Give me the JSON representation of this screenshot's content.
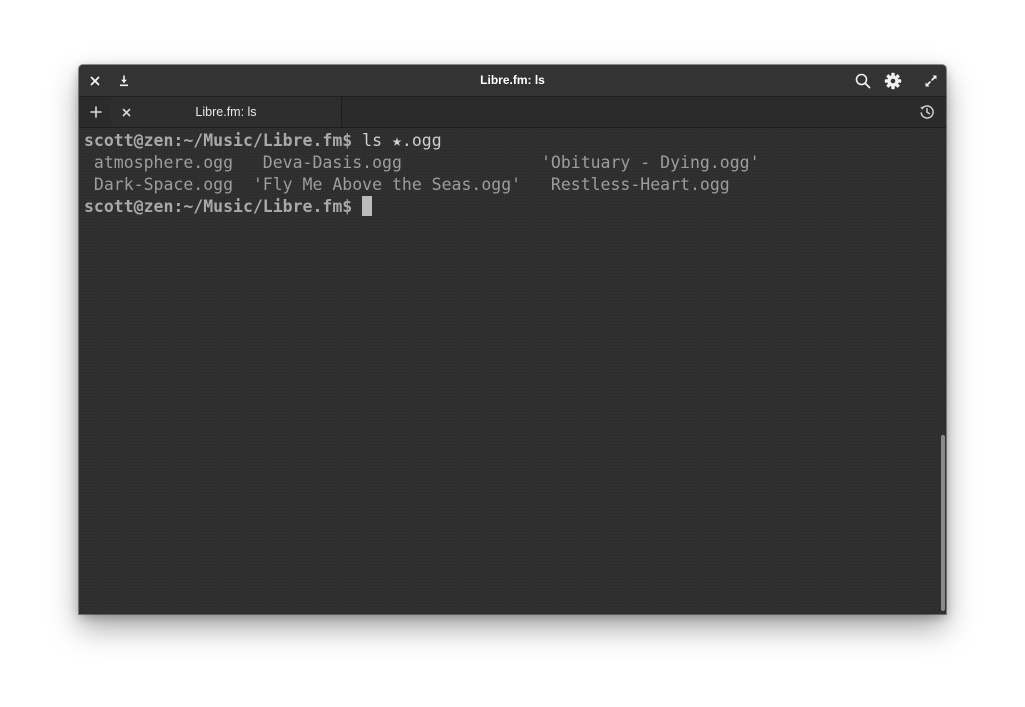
{
  "window": {
    "title": "Libre.fm: ls"
  },
  "titlebar": {
    "close_icon": "close-icon",
    "download_icon": "download-icon",
    "search_icon": "search-icon",
    "settings_icon": "gear-icon",
    "fullscreen_icon": "maximize-icon"
  },
  "tabs": {
    "new_tab_icon": "plus-icon",
    "items": [
      {
        "label": "Libre.fm: ls",
        "close_icon": "close-icon"
      }
    ],
    "history_icon": "history-icon"
  },
  "terminal": {
    "lines": [
      {
        "prompt": "scott@zen:~/Music/Libre.fm$",
        "command": " ls ★.ogg"
      },
      {
        "files": " atmosphere.ogg   Deva-Dasis.ogg              'Obituary - Dying.ogg'"
      },
      {
        "files": " Dark-Space.ogg  'Fly Me Above the Seas.ogg'   Restless-Heart.ogg"
      },
      {
        "prompt": "scott@zen:~/Music/Libre.fm$",
        "command": " "
      }
    ]
  },
  "colors": {
    "terminal_bg": "#303030",
    "prompt": "#a9a9a9",
    "titlebar_bg": "#333333"
  }
}
